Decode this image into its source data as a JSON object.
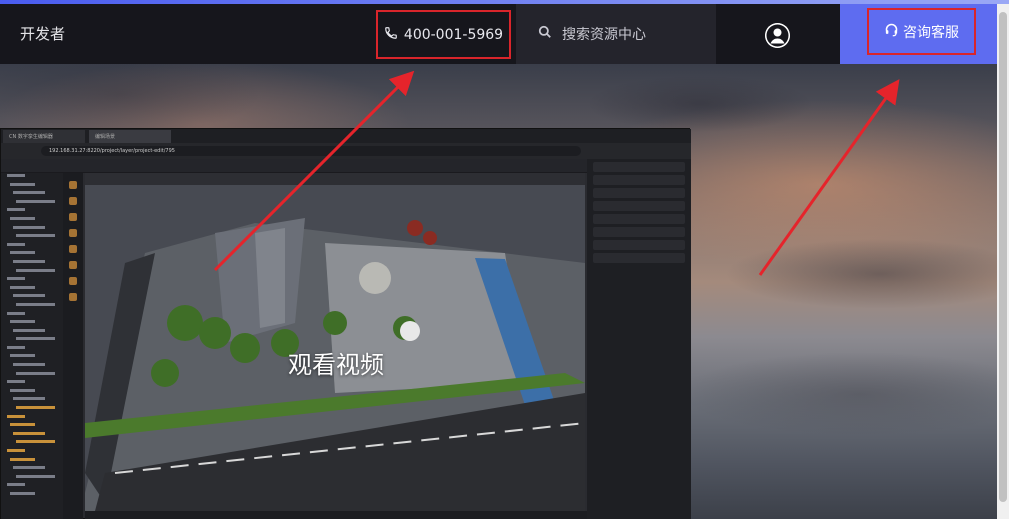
{
  "header": {
    "brand": "开发者",
    "phone": "400-001-5969",
    "search_label": "搜索资源中心",
    "consult_label": "咨询客服"
  },
  "hero": {
    "video_title": "观看视频",
    "app_preview": {
      "tabs": [
        "CN 数字孪生编辑器",
        "编辑场景"
      ],
      "url": "192.168.31.27:8220/project/layer/project-edit/795"
    }
  },
  "icons": {
    "phone": "phone-icon",
    "search": "search-icon",
    "avatar": "user-avatar-icon",
    "headset": "headset-icon"
  },
  "colors": {
    "header_bg": "#16161c",
    "accent": "#5e6cf0",
    "annotation_red": "#d9252b"
  }
}
